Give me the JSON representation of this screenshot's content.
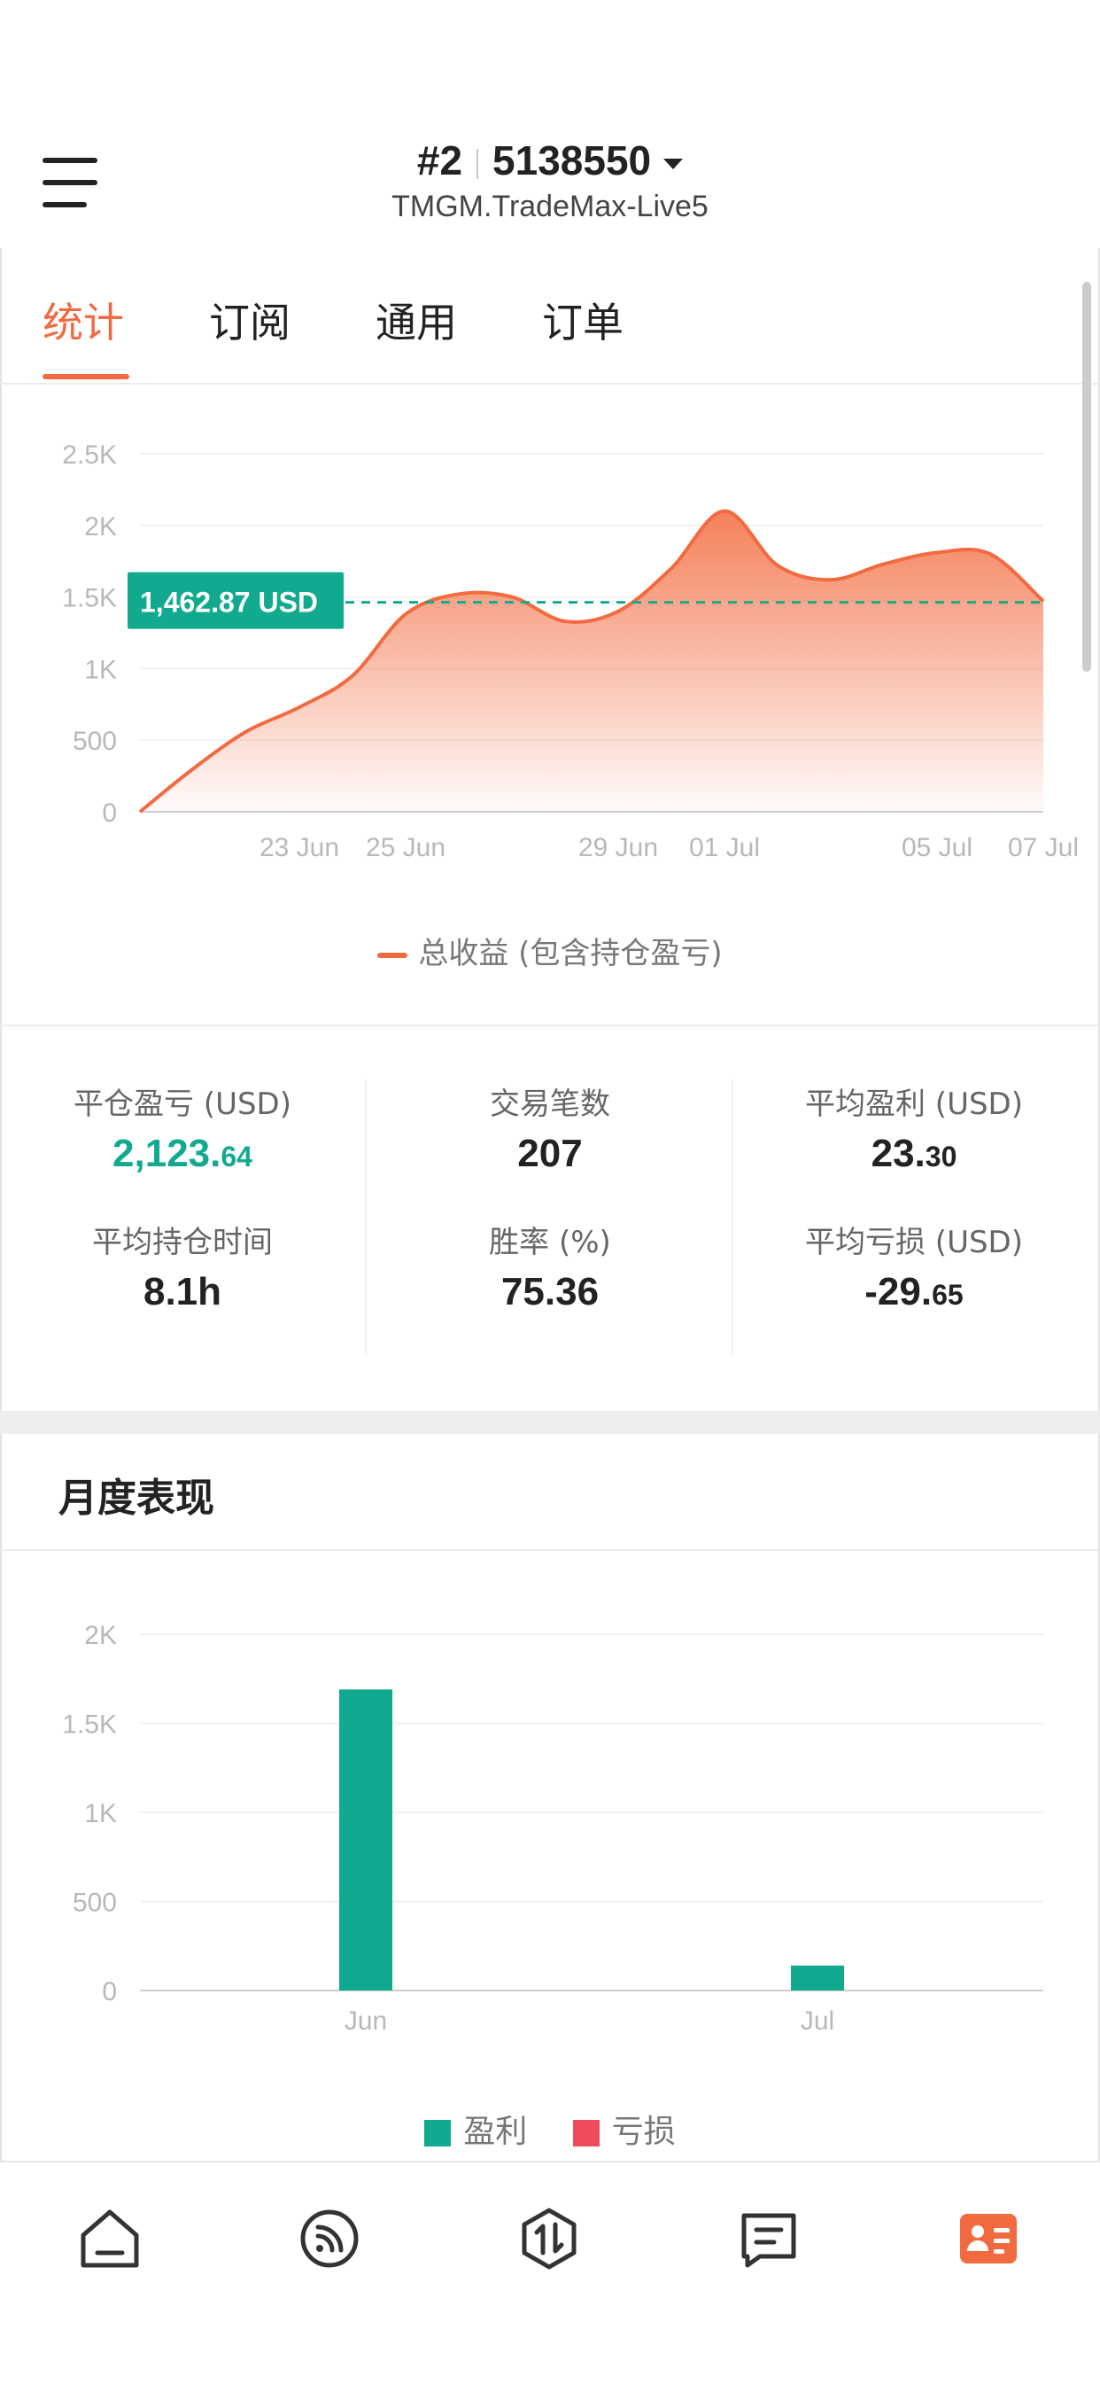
{
  "header": {
    "account_prefix": "#2",
    "account_number": "5138550",
    "server": "TMGM.TradeMax-Live5"
  },
  "tabs": [
    {
      "label": "统计",
      "active": true
    },
    {
      "label": "订阅",
      "active": false
    },
    {
      "label": "通用",
      "active": false
    },
    {
      "label": "订单",
      "active": false
    }
  ],
  "equity_chart_marker": "1,462.87 USD",
  "equity_legend": "总收益 (包含持仓盈亏)",
  "stats": {
    "closed_pnl_label": "平仓盈亏 (USD)",
    "closed_pnl_int": "2,123.",
    "closed_pnl_dec": "64",
    "trades_label": "交易笔数",
    "trades_value": "207",
    "avg_profit_label": "平均盈利 (USD)",
    "avg_profit_int": "23.",
    "avg_profit_dec": "30",
    "avg_hold_label": "平均持仓时间",
    "avg_hold_value": "8.1h",
    "win_rate_label": "胜率 (%)",
    "win_rate_value": "75.36",
    "avg_loss_label": "平均亏损 (USD)",
    "avg_loss_int": "-29.",
    "avg_loss_dec": "65"
  },
  "monthly_title": "月度表现",
  "monthly_legend": {
    "profit": "盈利",
    "loss": "亏损"
  },
  "colors": {
    "accent": "#f26a3f",
    "profit": "#12aa8f",
    "loss": "#ef4b5c"
  },
  "bottom_nav": [
    {
      "icon": "home-icon",
      "active": false
    },
    {
      "icon": "signal-feed-icon",
      "active": false
    },
    {
      "icon": "trade-icon",
      "active": false
    },
    {
      "icon": "message-icon",
      "active": false
    },
    {
      "icon": "profile-card-icon",
      "active": true
    }
  ],
  "chart_data": [
    {
      "type": "area",
      "series": [
        {
          "name": "总收益 (包含持仓盈亏)",
          "x": [
            "20 Jun",
            "21 Jun",
            "22 Jun",
            "23 Jun",
            "24 Jun",
            "25 Jun",
            "26 Jun",
            "27 Jun",
            "28 Jun",
            "29 Jun",
            "30 Jun",
            "01 Jul",
            "02 Jul",
            "03 Jul",
            "04 Jul",
            "05 Jul",
            "06 Jul",
            "07 Jul"
          ],
          "values": [
            0,
            300,
            560,
            730,
            950,
            1380,
            1520,
            1500,
            1330,
            1400,
            1700,
            2100,
            1720,
            1620,
            1730,
            1810,
            1800,
            1470
          ]
        }
      ],
      "x_ticks": [
        "23 Jun",
        "25 Jun",
        "29 Jun",
        "01 Jul",
        "05 Jul",
        "07 Jul"
      ],
      "y_ticks": [
        "0",
        "500",
        "1K",
        "1.5K",
        "2K",
        "2.5K"
      ],
      "ylim": [
        0,
        2500
      ],
      "reference_line": 1462.87,
      "grid": true,
      "legend_position": "bottom"
    },
    {
      "type": "bar",
      "categories": [
        "Jun",
        "Jul"
      ],
      "series": [
        {
          "name": "盈利",
          "values": [
            1690,
            140
          ]
        },
        {
          "name": "亏损",
          "values": [
            0,
            0
          ]
        }
      ],
      "y_ticks": [
        "0",
        "500",
        "1K",
        "1.5K",
        "2K"
      ],
      "ylim": [
        0,
        2000
      ],
      "grid": true,
      "legend_position": "bottom"
    }
  ]
}
